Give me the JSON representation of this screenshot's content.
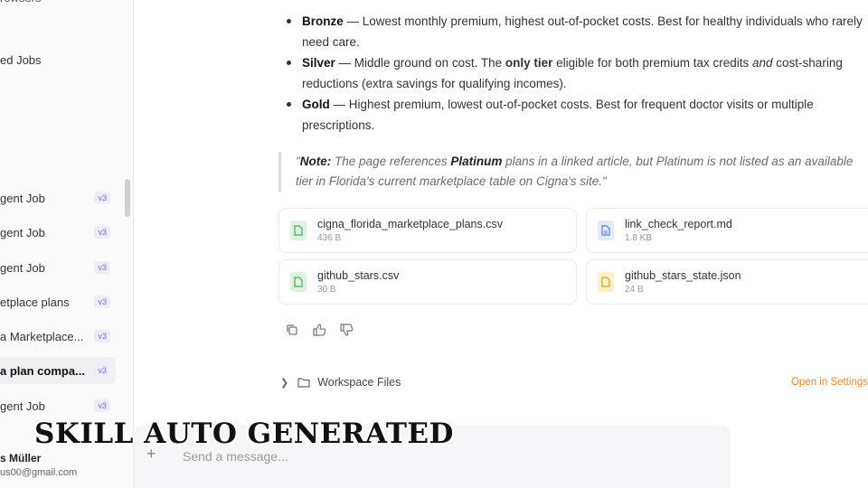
{
  "sidebar": {
    "top_partial": "rowsers",
    "saved_label": "ed Jobs",
    "items": [
      {
        "label": "gent Job",
        "badge": "v3"
      },
      {
        "label": "gent Job",
        "badge": "v3"
      },
      {
        "label": "gent Job",
        "badge": "v3"
      },
      {
        "label": "etplace plans",
        "badge": "v3"
      },
      {
        "label": "a Marketplace...",
        "badge": "v3"
      },
      {
        "label": "a plan compa...",
        "badge": "v3"
      },
      {
        "label": "gent Job",
        "badge": "v3"
      }
    ],
    "user": {
      "name": "s Müller",
      "email": "us00@gmail.com"
    }
  },
  "content": {
    "tiers": [
      {
        "name": "Bronze",
        "text": " — Lowest monthly premium, highest out-of-pocket costs. Best for healthy individuals who rarely need care."
      },
      {
        "name": "Silver",
        "text_a": " — Middle ground on cost. The ",
        "bold_mid": "only tier",
        "text_b": " eligible for both premium tax credits ",
        "italic_mid": "and",
        "text_c": " cost-sharing reductions (extra savings for qualifying incomes)."
      },
      {
        "name": "Gold",
        "text": " — Highest premium, lowest out-of-pocket costs. Best for frequent doctor visits or multiple prescriptions."
      }
    ],
    "note": {
      "open": "\"",
      "label": "Note:",
      "text_a": " The page references ",
      "highlight": "Platinum",
      "text_b": " plans in a linked article, but Platinum is not listed as an available tier in Florida's current marketplace table on Cigna's site.\""
    },
    "files": [
      {
        "name": "cigna_florida_marketplace_plans.csv",
        "size": "436 B",
        "icon": "csv-file-icon",
        "color": "#4aa65a"
      },
      {
        "name": "link_check_report.md",
        "size": "1.8 KB",
        "icon": "doc-file-icon",
        "color": "#5b7fd1"
      },
      {
        "name": "github_stars.csv",
        "size": "30 B",
        "icon": "csv-file-icon",
        "color": "#4aa65a"
      },
      {
        "name": "github_stars_state.json",
        "size": "24 B",
        "icon": "json-file-icon",
        "color": "#d1a52a"
      }
    ],
    "actions": [
      "copy-icon",
      "thumbs-up-icon",
      "thumbs-down-icon"
    ],
    "workspace": {
      "label": "Workspace Files",
      "link": "Open in Settings"
    }
  },
  "composer": {
    "placeholder": "Send a message..."
  },
  "overlay": {
    "caption": "SKILL AUTO GENERATED"
  },
  "colors": {
    "accent_link": "#e08a3a",
    "badge": "#7a6bd6"
  }
}
